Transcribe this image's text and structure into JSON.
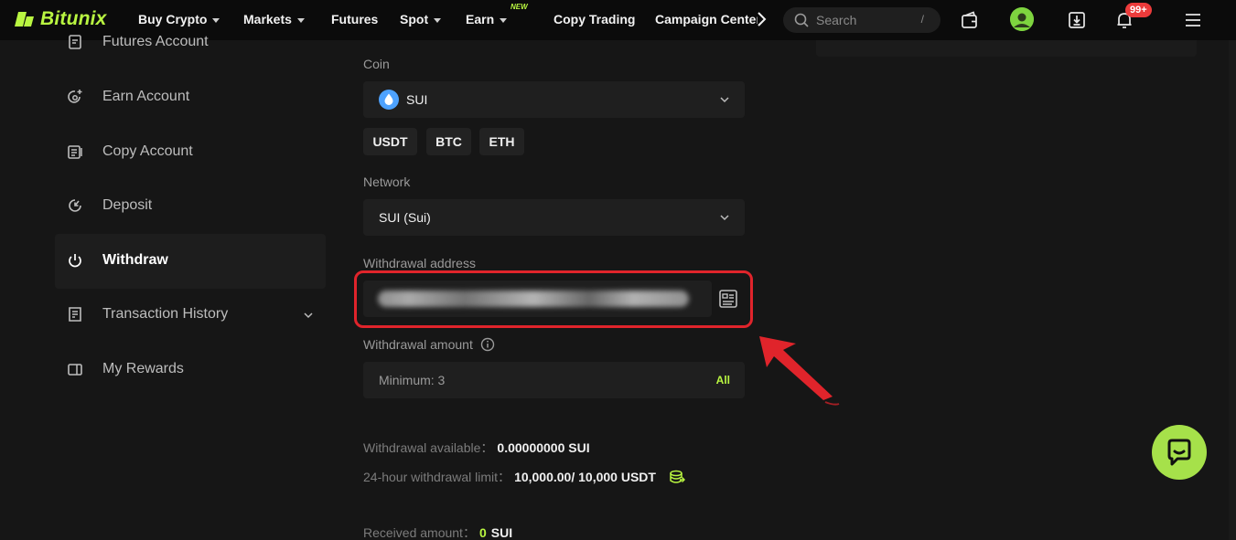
{
  "brand": {
    "name": "Bitunix",
    "accent": "#b9f641"
  },
  "topnav": {
    "items": [
      {
        "label": "Buy Crypto",
        "dropdown": true
      },
      {
        "label": "Markets",
        "dropdown": true
      },
      {
        "label": "Futures",
        "dropdown": false
      },
      {
        "label": "Spot",
        "dropdown": true
      },
      {
        "label": "Earn",
        "dropdown": true
      },
      {
        "label": "Copy Trading",
        "dropdown": false
      }
    ],
    "new_tag": "NEW",
    "campaign": "Campaign Center",
    "search_placeholder": "Search",
    "search_shortcut": "/",
    "notification_count": "99+"
  },
  "sidebar": {
    "items": [
      {
        "label": "Futures Account",
        "icon": "futures-account-icon"
      },
      {
        "label": "Earn Account",
        "icon": "earn-account-icon"
      },
      {
        "label": "Copy Account",
        "icon": "copy-account-icon"
      },
      {
        "label": "Deposit",
        "icon": "deposit-icon"
      },
      {
        "label": "Withdraw",
        "icon": "withdraw-icon",
        "active": true
      },
      {
        "label": "Transaction History",
        "icon": "transaction-history-icon",
        "expandable": true
      },
      {
        "label": "My Rewards",
        "icon": "my-rewards-icon"
      }
    ]
  },
  "form": {
    "coin_label": "Coin",
    "coin_value": "SUI",
    "quick_coins": [
      "USDT",
      "BTC",
      "ETH"
    ],
    "network_label": "Network",
    "network_value": "SUI (Sui)",
    "address_label": "Withdrawal address",
    "amount_label": "Withdrawal amount",
    "amount_placeholder": "Minimum: 3",
    "all_label": "All",
    "available_label": "Withdrawal available：",
    "available_value": "0.00000000 SUI",
    "limit_label": "24-hour withdrawal limit：",
    "limit_value": "10,000.00/ 10,000 USDT",
    "received_label": "Received amount：",
    "received_value": "0",
    "received_unit": "SUI"
  },
  "annotation": {
    "highlight_color": "#e0242b"
  }
}
